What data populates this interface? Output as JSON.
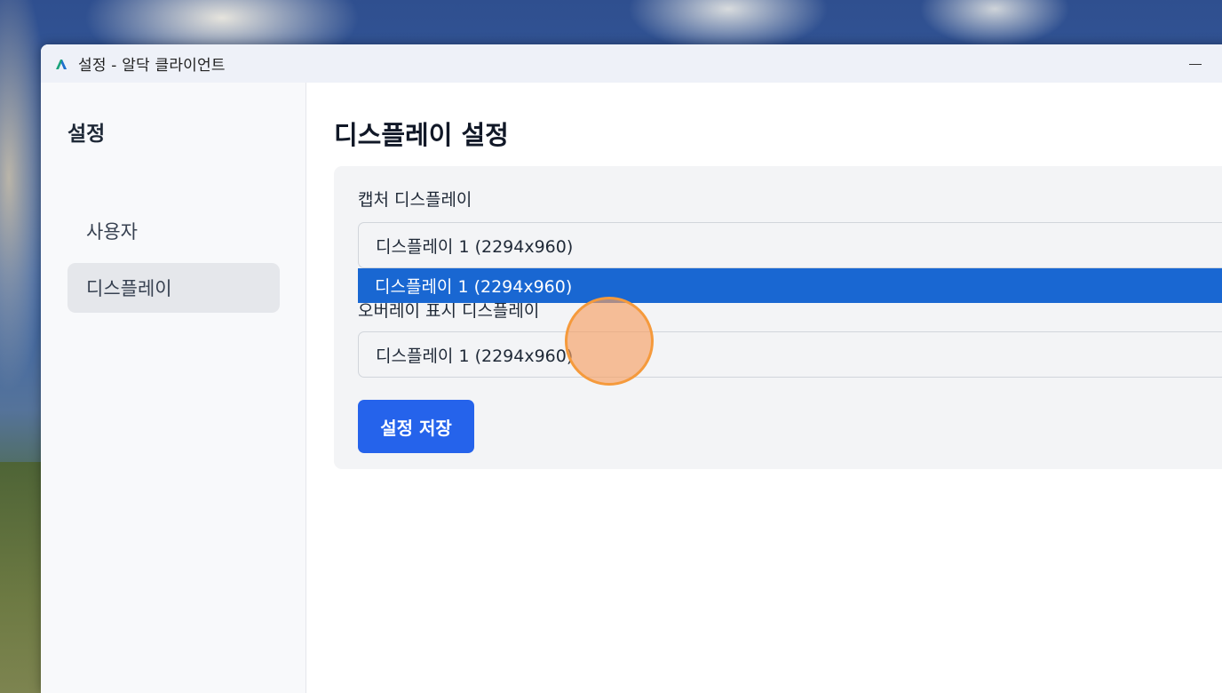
{
  "window": {
    "title": "설정 - 알닥 클라이언트",
    "app_icon": "alduck-logo-icon",
    "controls": {
      "minimize_icon": "minimize-icon"
    }
  },
  "sidebar": {
    "title": "설정",
    "items": [
      {
        "label": "사용자",
        "active": false
      },
      {
        "label": "디스플레이",
        "active": true
      }
    ]
  },
  "main": {
    "title": "디스플레이 설정",
    "capture_display": {
      "label": "캡처 디스플레이",
      "value": "디스플레이 1 (2294x960)",
      "dropdown_open": true,
      "options": [
        "디스플레이 1 (2294x960)"
      ],
      "highlighted_option": "디스플레이 1 (2294x960)"
    },
    "overlay_display": {
      "label": "오버레이 표시 디스플레이",
      "value": "디스플레이 1 (2294x960)"
    },
    "save_button": "설정 저장"
  },
  "colors": {
    "accent": "#2563eb",
    "dropdown_highlight": "#1967d2",
    "click_indicator": "#f59a3c"
  }
}
